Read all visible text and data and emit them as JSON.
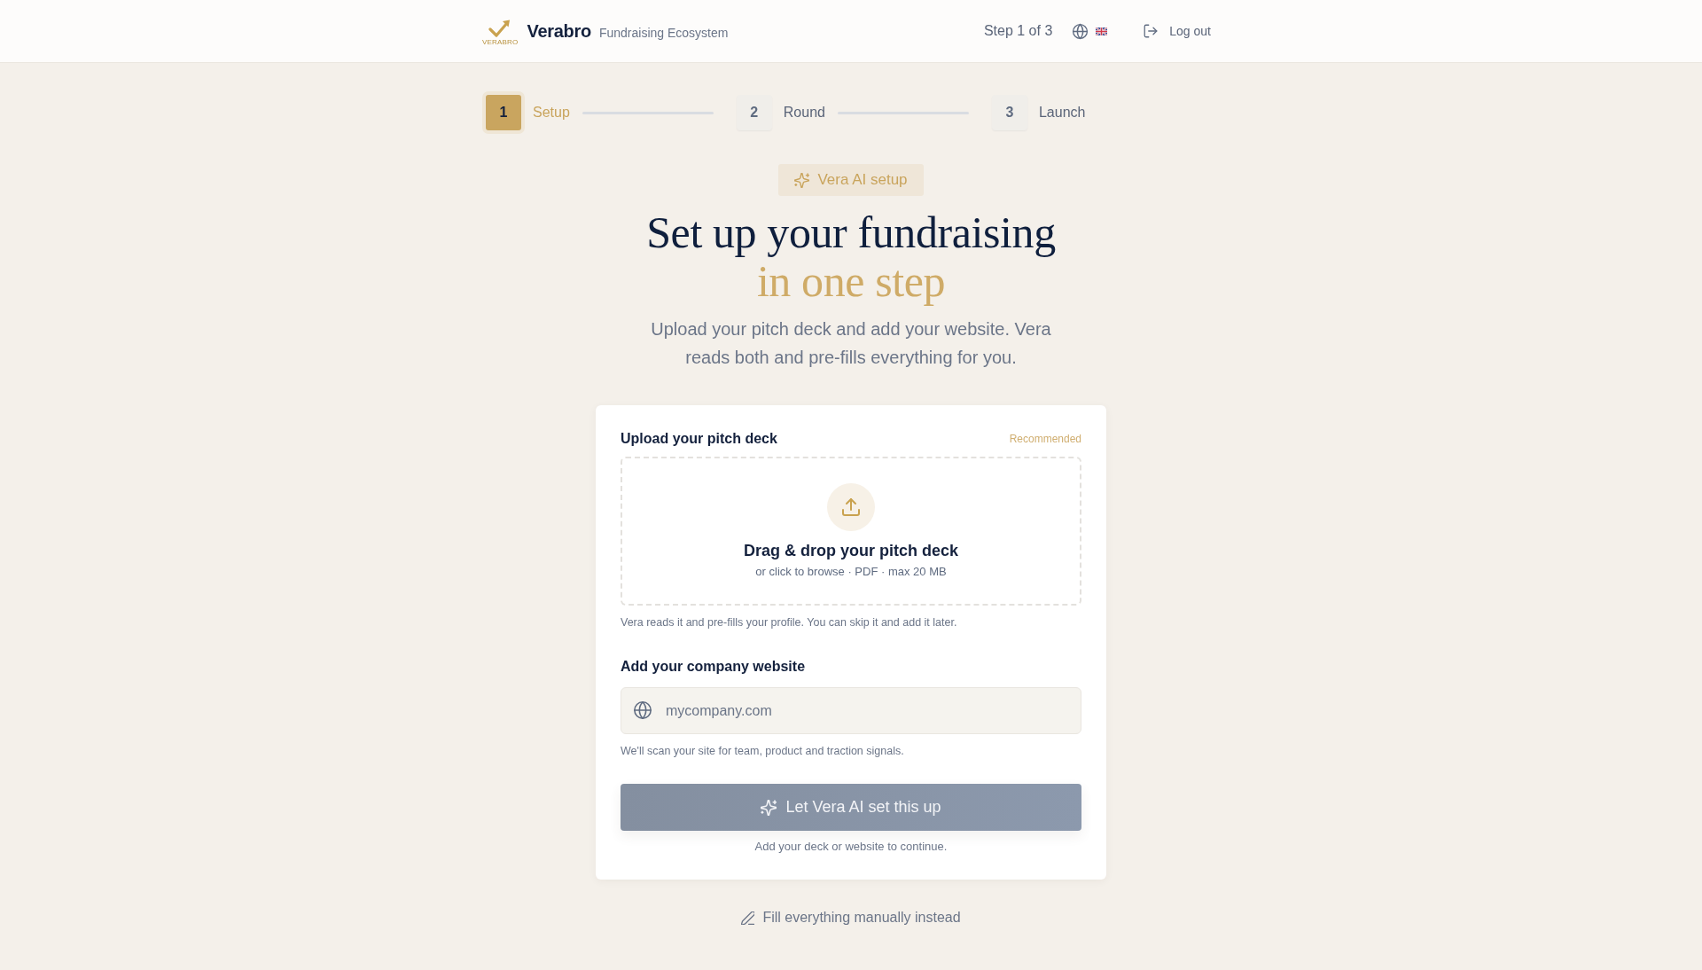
{
  "header": {
    "logo_caption": "VERABRO",
    "brand": "Verabro",
    "tagline": "Fundraising Ecosystem",
    "step_indicator": "Step 1 of 3",
    "logout": "Log out"
  },
  "stepper": [
    {
      "number": "1",
      "label": "Setup",
      "selected": true
    },
    {
      "number": "2",
      "label": "Round",
      "selected": false
    },
    {
      "number": "3",
      "label": "Launch",
      "selected": false
    }
  ],
  "badge": "Vera AI setup",
  "title": "Set up your fundraising",
  "title_accent": "in one step",
  "subtitle": "Upload your pitch deck and add your website. Vera reads both and pre-fills everything for you.",
  "card": {
    "deck": {
      "label": "Upload your pitch deck",
      "tag": "Recommended",
      "drop_title": "Drag & drop your pitch deck",
      "drop_hint": "or click to browse · PDF · max 20 MB",
      "help": "Vera reads it and pre-fills your profile. You can skip it and add it later."
    },
    "website": {
      "label": "Add your company website",
      "placeholder": "mycompany.com",
      "help": "We'll scan your site for team, product and traction signals."
    },
    "submit": {
      "label": "Let Vera AI set this up",
      "disabled": true
    },
    "note": "Add your deck or website to continue."
  },
  "manual_link": "Fill everything manually instead"
}
